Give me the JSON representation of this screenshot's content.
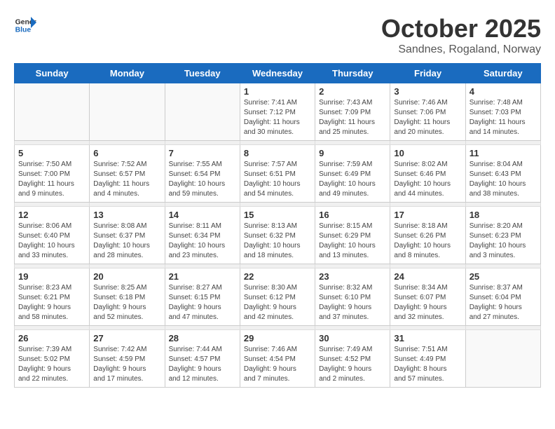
{
  "logo": {
    "general": "General",
    "blue": "Blue"
  },
  "header": {
    "month": "October 2025",
    "location": "Sandnes, Rogaland, Norway"
  },
  "weekdays": [
    "Sunday",
    "Monday",
    "Tuesday",
    "Wednesday",
    "Thursday",
    "Friday",
    "Saturday"
  ],
  "weeks": [
    [
      {
        "day": "",
        "info": ""
      },
      {
        "day": "",
        "info": ""
      },
      {
        "day": "",
        "info": ""
      },
      {
        "day": "1",
        "info": "Sunrise: 7:41 AM\nSunset: 7:12 PM\nDaylight: 11 hours\nand 30 minutes."
      },
      {
        "day": "2",
        "info": "Sunrise: 7:43 AM\nSunset: 7:09 PM\nDaylight: 11 hours\nand 25 minutes."
      },
      {
        "day": "3",
        "info": "Sunrise: 7:46 AM\nSunset: 7:06 PM\nDaylight: 11 hours\nand 20 minutes."
      },
      {
        "day": "4",
        "info": "Sunrise: 7:48 AM\nSunset: 7:03 PM\nDaylight: 11 hours\nand 14 minutes."
      }
    ],
    [
      {
        "day": "5",
        "info": "Sunrise: 7:50 AM\nSunset: 7:00 PM\nDaylight: 11 hours\nand 9 minutes."
      },
      {
        "day": "6",
        "info": "Sunrise: 7:52 AM\nSunset: 6:57 PM\nDaylight: 11 hours\nand 4 minutes."
      },
      {
        "day": "7",
        "info": "Sunrise: 7:55 AM\nSunset: 6:54 PM\nDaylight: 10 hours\nand 59 minutes."
      },
      {
        "day": "8",
        "info": "Sunrise: 7:57 AM\nSunset: 6:51 PM\nDaylight: 10 hours\nand 54 minutes."
      },
      {
        "day": "9",
        "info": "Sunrise: 7:59 AM\nSunset: 6:49 PM\nDaylight: 10 hours\nand 49 minutes."
      },
      {
        "day": "10",
        "info": "Sunrise: 8:02 AM\nSunset: 6:46 PM\nDaylight: 10 hours\nand 44 minutes."
      },
      {
        "day": "11",
        "info": "Sunrise: 8:04 AM\nSunset: 6:43 PM\nDaylight: 10 hours\nand 38 minutes."
      }
    ],
    [
      {
        "day": "12",
        "info": "Sunrise: 8:06 AM\nSunset: 6:40 PM\nDaylight: 10 hours\nand 33 minutes."
      },
      {
        "day": "13",
        "info": "Sunrise: 8:08 AM\nSunset: 6:37 PM\nDaylight: 10 hours\nand 28 minutes."
      },
      {
        "day": "14",
        "info": "Sunrise: 8:11 AM\nSunset: 6:34 PM\nDaylight: 10 hours\nand 23 minutes."
      },
      {
        "day": "15",
        "info": "Sunrise: 8:13 AM\nSunset: 6:32 PM\nDaylight: 10 hours\nand 18 minutes."
      },
      {
        "day": "16",
        "info": "Sunrise: 8:15 AM\nSunset: 6:29 PM\nDaylight: 10 hours\nand 13 minutes."
      },
      {
        "day": "17",
        "info": "Sunrise: 8:18 AM\nSunset: 6:26 PM\nDaylight: 10 hours\nand 8 minutes."
      },
      {
        "day": "18",
        "info": "Sunrise: 8:20 AM\nSunset: 6:23 PM\nDaylight: 10 hours\nand 3 minutes."
      }
    ],
    [
      {
        "day": "19",
        "info": "Sunrise: 8:23 AM\nSunset: 6:21 PM\nDaylight: 9 hours\nand 58 minutes."
      },
      {
        "day": "20",
        "info": "Sunrise: 8:25 AM\nSunset: 6:18 PM\nDaylight: 9 hours\nand 52 minutes."
      },
      {
        "day": "21",
        "info": "Sunrise: 8:27 AM\nSunset: 6:15 PM\nDaylight: 9 hours\nand 47 minutes."
      },
      {
        "day": "22",
        "info": "Sunrise: 8:30 AM\nSunset: 6:12 PM\nDaylight: 9 hours\nand 42 minutes."
      },
      {
        "day": "23",
        "info": "Sunrise: 8:32 AM\nSunset: 6:10 PM\nDaylight: 9 hours\nand 37 minutes."
      },
      {
        "day": "24",
        "info": "Sunrise: 8:34 AM\nSunset: 6:07 PM\nDaylight: 9 hours\nand 32 minutes."
      },
      {
        "day": "25",
        "info": "Sunrise: 8:37 AM\nSunset: 6:04 PM\nDaylight: 9 hours\nand 27 minutes."
      }
    ],
    [
      {
        "day": "26",
        "info": "Sunrise: 7:39 AM\nSunset: 5:02 PM\nDaylight: 9 hours\nand 22 minutes."
      },
      {
        "day": "27",
        "info": "Sunrise: 7:42 AM\nSunset: 4:59 PM\nDaylight: 9 hours\nand 17 minutes."
      },
      {
        "day": "28",
        "info": "Sunrise: 7:44 AM\nSunset: 4:57 PM\nDaylight: 9 hours\nand 12 minutes."
      },
      {
        "day": "29",
        "info": "Sunrise: 7:46 AM\nSunset: 4:54 PM\nDaylight: 9 hours\nand 7 minutes."
      },
      {
        "day": "30",
        "info": "Sunrise: 7:49 AM\nSunset: 4:52 PM\nDaylight: 9 hours\nand 2 minutes."
      },
      {
        "day": "31",
        "info": "Sunrise: 7:51 AM\nSunset: 4:49 PM\nDaylight: 8 hours\nand 57 minutes."
      },
      {
        "day": "",
        "info": ""
      }
    ]
  ]
}
